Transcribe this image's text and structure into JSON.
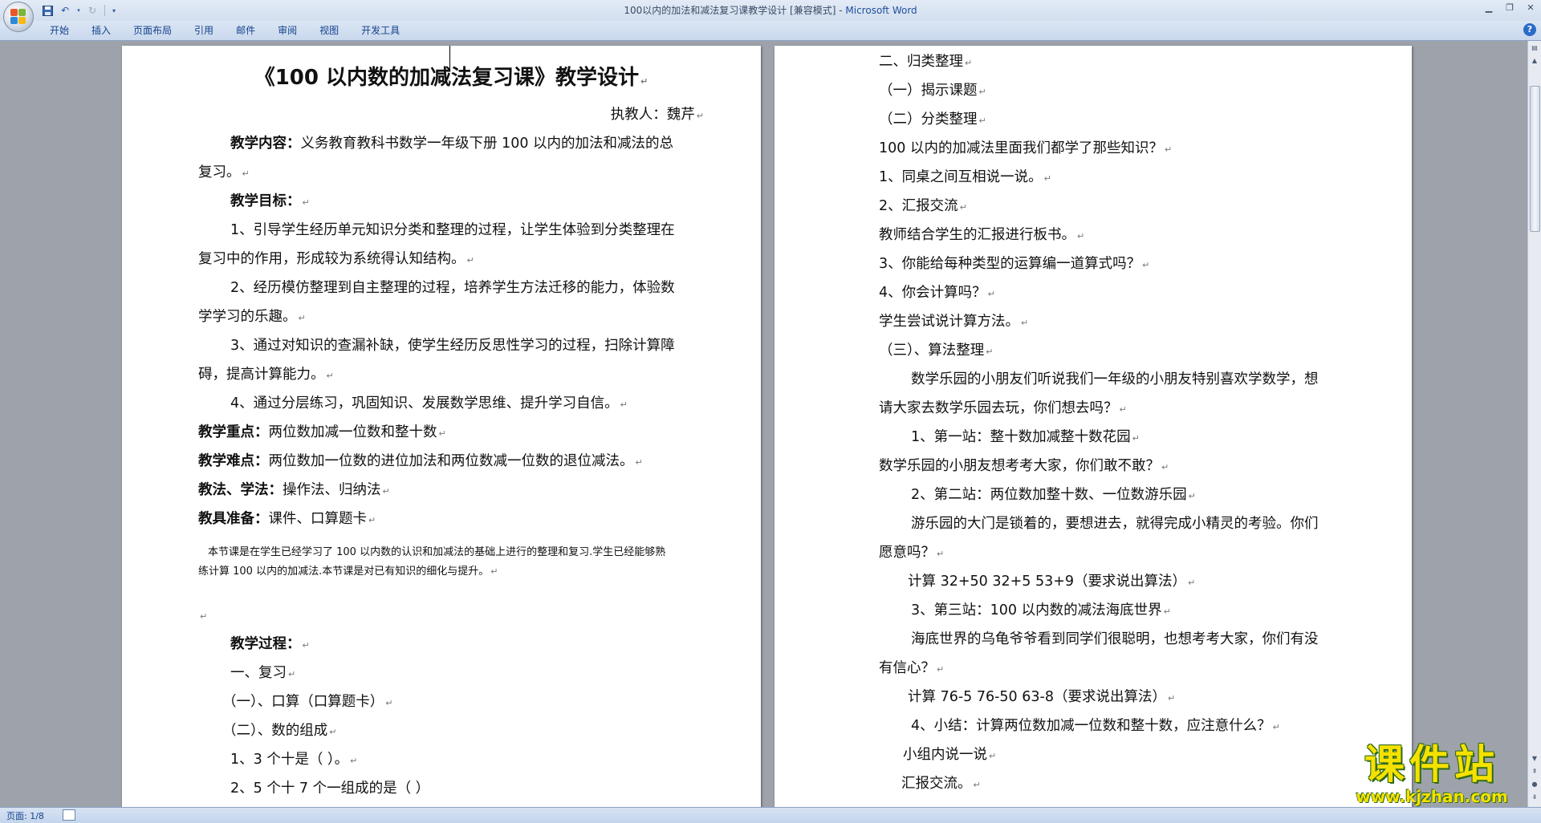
{
  "window": {
    "title": "100以内的加法和减法复习课教学设计 [兼容模式]",
    "app_name": "Microsoft Word",
    "title_separator": " - "
  },
  "ribbon": {
    "tabs": [
      "开始",
      "插入",
      "页面布局",
      "引用",
      "邮件",
      "审阅",
      "视图",
      "开发工具"
    ],
    "help_label": "?"
  },
  "left_page": {
    "title": "《100 以内数的加减法复习课》教学设计",
    "author": "执教人：魏芹",
    "content_label": "教学内容：",
    "content_text": "义务教育教科书数学一年级下册 100 以内的加法和减法的总",
    "content_text2": "复习。",
    "goals_label": "教学目标：",
    "goal1a": "1、引导学生经历单元知识分类和整理的过程，让学生体验到分类整理在",
    "goal1b": "复习中的作用，形成较为系统得认知结构。",
    "goal2a": "2、经历模仿整理到自主整理的过程，培养学生方法迁移的能力，体验数",
    "goal2b": "学学习的乐趣。",
    "goal3a": "3、通过对知识的查漏补缺，使学生经历反思性学习的过程，扫除计算障",
    "goal3b": "碍，提高计算能力。",
    "goal4": "4、通过分层练习，巩固知识、发展数学思维、提升学习自信。",
    "key_label": "教学重点：",
    "key_text": "两位数加减一位数和整十数",
    "difficult_label": "教学难点：",
    "difficult_text": "两位数加一位数的进位加法和两位数减一位数的退位减法。",
    "method_label": "教法、学法：",
    "method_text": "操作法、归纳法",
    "tools_label": "教具准备：",
    "tools_text": "课件、口算题卡",
    "note1": "本节课是在学生已经学习了 100 以内数的认识和加减法的基础上进行的整理和复习.学生已经能够熟",
    "note2": "练计算 100 以内的加减法.本节课是对已有知识的细化与提升。",
    "process_label": "教学过程：",
    "review": "一、复习",
    "review1": "（一）、口算（口算题卡）",
    "review2": "（二）、数的组成",
    "review2_1": "1、3 个十是（   ）。",
    "review2_2": "2、5 个十 7 个一组成的是（   ）"
  },
  "right_page": {
    "lines": [
      "二、归类整理",
      "（一）揭示课题",
      "（二）分类整理",
      "100 以内的加减法里面我们都学了那些知识？",
      "1、同桌之间互相说一说。",
      "2、汇报交流",
      "教师结合学生的汇报进行板书。",
      "3、你能给每种类型的运算编一道算式吗？",
      "4、你会计算吗？",
      "学生尝试说计算方法。",
      "（三）、算法整理",
      "数学乐园的小朋友们听说我们一年级的小朋友特别喜欢学数学，想",
      "请大家去数学乐园去玩，你们想去吗？",
      "1、第一站：整十数加减整十数花园",
      "数学乐园的小朋友想考考大家，你们敢不敢？",
      "2、第二站：两位数加整十数、一位数游乐园",
      "游乐园的大门是锁着的，要想进去，就得完成小精灵的考验。你们",
      "愿意吗？",
      "计算 32+50     32+5       53+9（要求说出算法）",
      "3、第三站：100 以内数的减法海底世界",
      "海底世界的乌龟爷爷看到同学们很聪明，也想考考大家，你们有没",
      "有信心？",
      "计算 76-5     76-50    63-8（要求说出算法）",
      "4、小结：计算两位数加减一位数和整十数，应注意什么？",
      "小组内说一说",
      "汇报交流。"
    ]
  },
  "status": {
    "page": "页面: 1/8"
  },
  "watermark": {
    "main": "课件站",
    "url": "www.kjzhan.com"
  },
  "colors": {
    "accent": "#15428b",
    "watermark": "#f5e100",
    "workspace": "#9ea3ab"
  }
}
